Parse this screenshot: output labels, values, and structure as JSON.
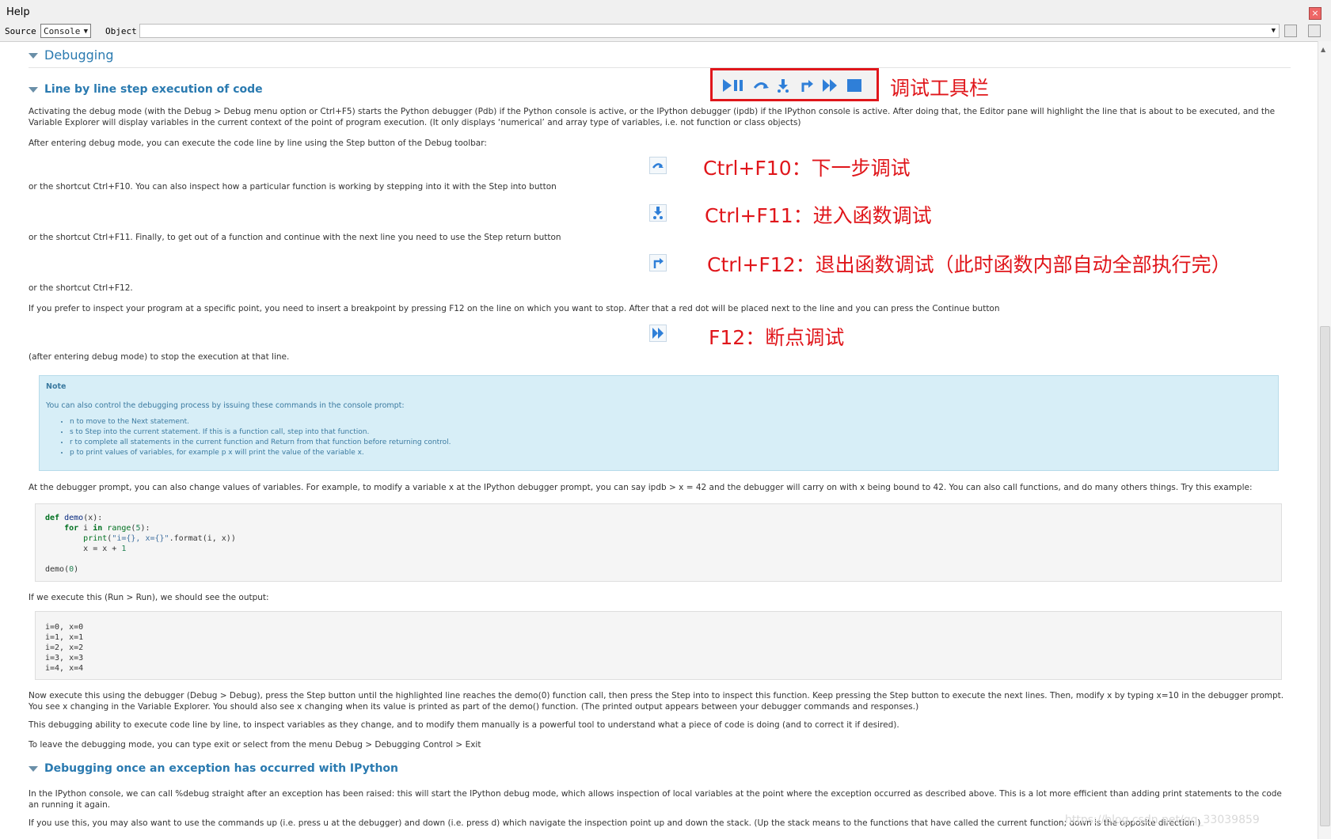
{
  "window": {
    "title": "Help"
  },
  "source_bar": {
    "source_label": "Source",
    "source_value": "Console",
    "object_label": "Object",
    "object_value": ""
  },
  "sections": {
    "debugging": "Debugging",
    "line_by_line": "Line by line step execution of code",
    "exception": "Debugging once an exception has occurred with IPython"
  },
  "paragraphs": {
    "p1": "Activating the debug mode (with the Debug  >  Debug menu option or Ctrl+F5) starts the Python debugger (Pdb) if the Python console is active, or the IPython debugger (ipdb) if the IPython console is active. After doing that, the Editor pane will highlight the line that is about to be executed, and the Variable Explorer will display variables in the current context of the point of program execution. (It only displays ‘numerical’ and array type of variables, i.e. not function or class objects)",
    "p2": "After entering debug mode, you can execute the code line by line using the Step button of the Debug toolbar:",
    "p3": "or the shortcut Ctrl+F10. You can also inspect how a particular function is working by stepping into it with the Step  into button",
    "p4": "or the shortcut Ctrl+F11. Finally, to get out of a function and continue with the next line you need to use the Step  return button",
    "p5": "or the shortcut Ctrl+F12.",
    "p6": "If you prefer to inspect your program at a specific point, you need to insert a breakpoint by pressing F12 on the line on which you want to stop. After that a red dot will be placed next to the line and you can press the Continue button",
    "p7": "(after entering debug mode) to stop the execution at that line.",
    "p8": "At the debugger prompt, you can also change values of variables. For example, to modify a variable x at the IPython debugger prompt, you can say ipdb  >  x  =  42 and the debugger will carry on with x being bound to 42. You can also call functions, and do many others things. Try this example:",
    "p9": "If we execute this (Run  >  Run), we should see the output:",
    "p10": "Now execute this using the debugger (Debug  >  Debug), press the Step  button until the highlighted line reaches the demo(0) function call, then press the Step  into to inspect this function. Keep pressing the Step  button to execute the next lines. Then, modify x by typing x=10 in the debugger prompt. You see x changing in the Variable Explorer. You should also see x changing when its value is printed as part of the demo() function. (The printed output appears between your debugger commands and responses.)",
    "p11": "This debugging ability to execute code line by line, to inspect variables as they change, and to modify them manually is a powerful tool to understand what a piece of code is doing (and to correct it if desired).",
    "p12": "To leave the debugging mode, you can type exit or select from the menu Debug  >  Debugging  Control  >  Exit",
    "p13": "In the IPython console, we can call %debug straight after an exception has been raised: this will start the IPython debug mode, which allows inspection of local variables at the point where the exception occurred as described above. This is a lot more efficient than adding print statements to the code an running it again.",
    "p14": "If you use this, you may also want to use the commands up (i.e. press u at the debugger) and down (i.e. press d) which navigate the inspection point up and down the stack. (Up the stack means to the functions that have called the current function; down is the opposite direction.)"
  },
  "note": {
    "title": "Note",
    "intro": "You can also control the debugging process by issuing these commands in the console prompt:",
    "items": [
      "n to move to the Next statement.",
      "s to Step into the current statement. If this is a function call, step into that function.",
      "r to complete all statements in the current function and Return from that function before returning control.",
      "p to print values of variables, for example p  x will print the value of the variable x."
    ]
  },
  "code_example": [
    "def demo(x):",
    "    for i in range(5):",
    "        print(\"i={}, x={}\".format(i, x))",
    "        x = x + 1",
    "",
    "demo(0)"
  ],
  "output_example": [
    "i=0, x=0",
    "i=1, x=1",
    "i=2, x=2",
    "i=3, x=3",
    "i=4, x=4"
  ],
  "annotations": {
    "toolbar": "调试工具栏",
    "step": "Ctrl+F10：下一步调试",
    "step_into": "Ctrl+F11：进入函数调试",
    "step_return": "Ctrl+F12：退出函数调试（此时函数内部自动全部执行完）",
    "continue": "F12：断点调试"
  },
  "watermark": "https://blog.csdn.net/qq_33039859",
  "colors": {
    "accent": "#2a7ab0",
    "annotation_red": "#e0161b",
    "note_bg": "#d7eef7"
  }
}
